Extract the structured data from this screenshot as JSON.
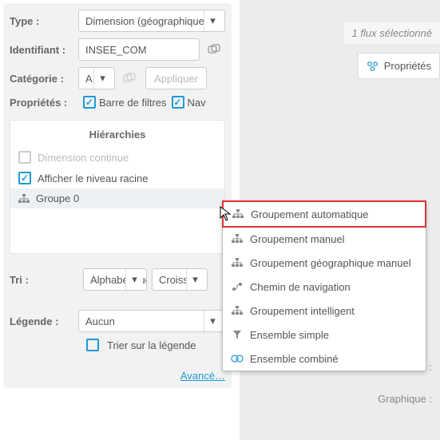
{
  "form": {
    "type_label": "Type :",
    "type_value": "Dimension (géographique)",
    "id_label": "Identifiant :",
    "id_value": "INSEE_COM",
    "cat_label": "Catégorie :",
    "cat_value": "A",
    "apply": "Appliquer",
    "props_label": "Propriétés :",
    "cb_filter": "Barre de filtres",
    "cb_nav": "Nav"
  },
  "hier": {
    "title": "Hiérarchies",
    "dim_continue": "Dimension continue",
    "show_root": "Afficher le niveau racine",
    "group0": "Groupe 0"
  },
  "tri": {
    "label": "Tri :",
    "order": "Alphabétique",
    "dir": "Croissant"
  },
  "legend": {
    "label": "Légende :",
    "value": "Aucun",
    "sort": "Trier sur la légende"
  },
  "advanced": "Avancé…",
  "menu": {
    "auto": "Groupement automatique",
    "manual": "Groupement manuel",
    "geo": "Groupement géographique manuel",
    "nav": "Chemin de navigation",
    "smart": "Groupement intelligent",
    "simple": "Ensemble simple",
    "combined": "Ensemble combiné"
  },
  "right": {
    "flow": "1 flux sélectionné",
    "prop": "Propriétés",
    "model": "Modèle :",
    "chart": "Graphique :"
  }
}
